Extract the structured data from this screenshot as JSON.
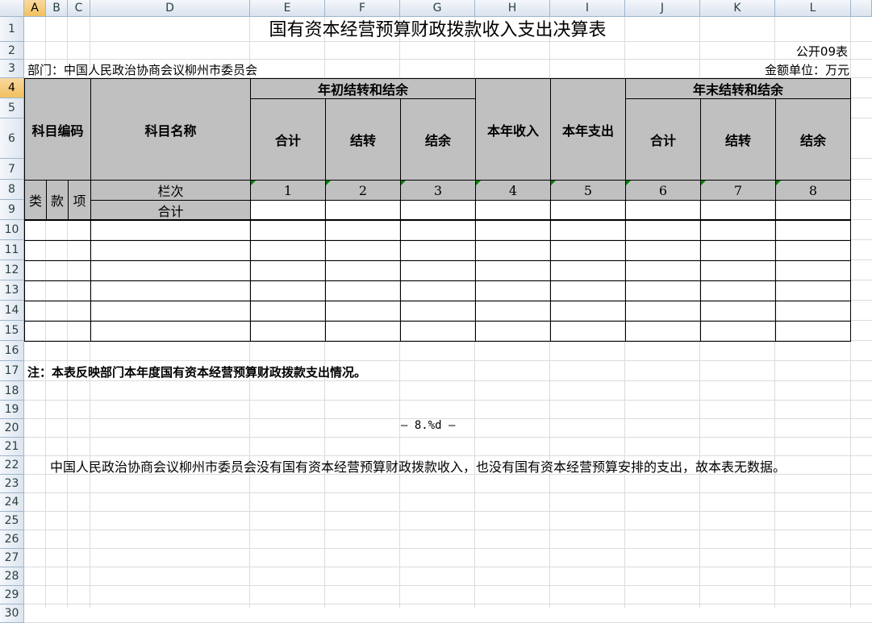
{
  "columns": [
    "A",
    "B",
    "C",
    "D",
    "E",
    "F",
    "G",
    "H",
    "I",
    "J",
    "K",
    "L"
  ],
  "rows": [
    "1",
    "2",
    "3",
    "4",
    "5",
    "6",
    "7",
    "8",
    "9",
    "10",
    "11",
    "12",
    "13",
    "14",
    "15",
    "16",
    "17",
    "18",
    "19",
    "20",
    "21",
    "22",
    "23",
    "24",
    "25",
    "26",
    "27",
    "28",
    "29",
    "30"
  ],
  "selected_column": "A",
  "selected_row": "4",
  "sheet": {
    "title": "国有资本经营预算财政拨款收入支出决算表",
    "form_no": "公开09表",
    "department": "部门：中国人民政治协商会议柳州市委员会",
    "unit": "金额单位：万元",
    "header": {
      "subject_code": "科目编码",
      "subject_name": "科目名称",
      "begin_group": "年初结转和结余",
      "begin_total": "合计",
      "begin_carry": "结转",
      "begin_balance": "结余",
      "income": "本年收入",
      "expense": "本年支出",
      "end_group": "年末结转和结余",
      "end_total": "合计",
      "end_carry": "结转",
      "end_balance": "结余",
      "lei": "类",
      "kuan": "款",
      "xiang": "项",
      "column_index": "栏次",
      "col_numbers": [
        "1",
        "2",
        "3",
        "4",
        "5",
        "6",
        "7",
        "8"
      ],
      "total_row": "合计"
    },
    "note": "注：本表反映部门本年度国有资本经营预算财政拨款支出情况。",
    "page_marker": "— 8.%d —",
    "statement": "中国人民政治协商会议柳州市委员会没有国有资本经营预算财政拨款收入，也没有国有资本经营预算安排的支出，故本表无数据。"
  }
}
